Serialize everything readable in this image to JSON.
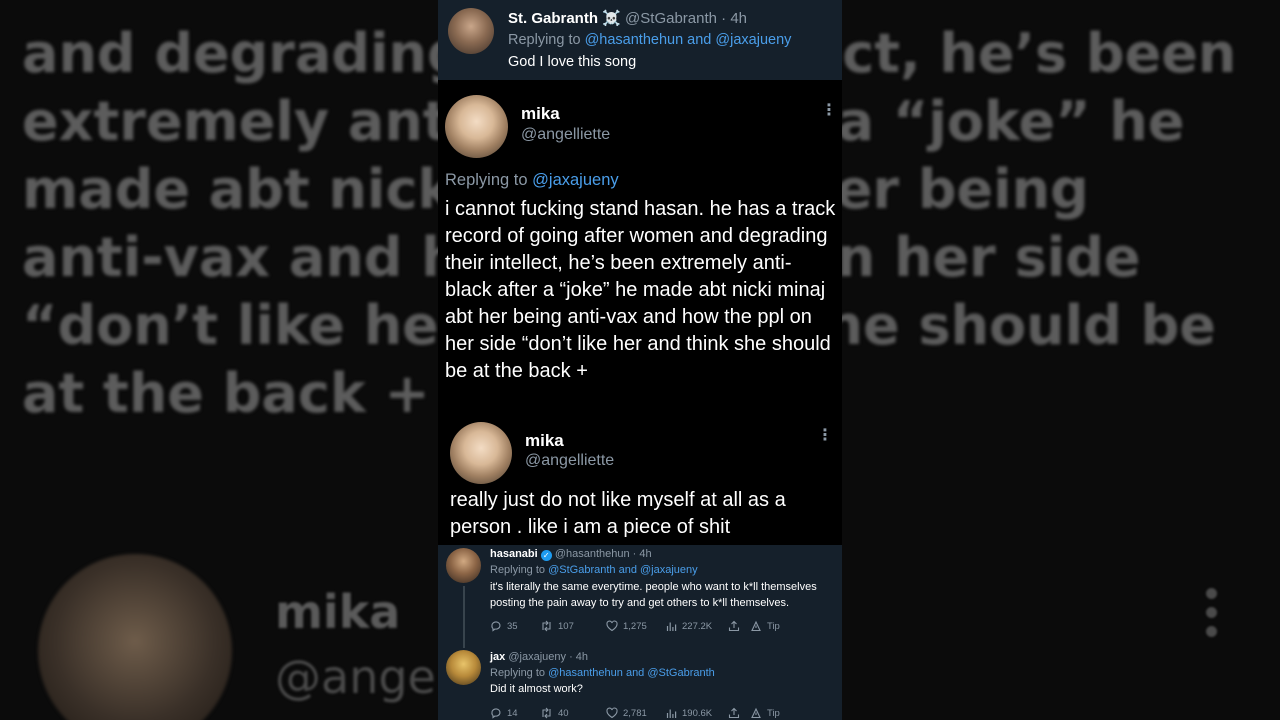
{
  "background": {
    "lines": [
      "and degrading their intellect, he’s been",
      "extremely anti-black after a “joke” he",
      "made abt nicki minaj abt her being",
      "anti-vax and how the ppl on her side",
      "“don’t like her and think she should be",
      "at the back +"
    ],
    "name": "mika",
    "handle": "@angelliette"
  },
  "tweet_top": {
    "name": "St. Gabranth",
    "emoji": "☠️",
    "handle": "@StGabranth",
    "time": "· 4h",
    "replying_prefix": "Replying to",
    "replying_to": "@hasanthehun and @jaxajueny",
    "text": "God I love this song"
  },
  "tweet_mika_1": {
    "name": "mika",
    "handle": "@angelliette",
    "more_icon": "⋮",
    "replying_prefix": "Replying to",
    "replying_to": "@jaxajueny",
    "text": "i cannot fucking stand hasan. he has a track record of going after women and degrading their intellect, he’s been extremely anti-black after a “joke” he made abt nicki minaj abt her being anti-vax and how the ppl on her side “don’t like her and think she should be at the back +"
  },
  "tweet_mika_2": {
    "name": "mika",
    "handle": "@angelliette",
    "more_icon": "⋮",
    "text": "really just do not like myself at all as a person . like i am a piece of shit"
  },
  "tweet_hasan": {
    "name": "hasanabi",
    "verified_icon": "✓",
    "handle": "@hasanthehun",
    "time": "· 4h",
    "replying_prefix": "Replying to",
    "replying_to": "@StGabranth and @jaxajueny",
    "text": "it's literally the same everytime. people who want to k*ll themselves posting the pain away to try and get others to k*ll themselves.",
    "replies": "35",
    "retweets": "107",
    "likes": "1,275",
    "views": "227.2K",
    "tip": "Tip"
  },
  "tweet_jax": {
    "name": "jax",
    "handle": "@jaxajueny",
    "time": "· 4h",
    "replying_prefix": "Replying to",
    "replying_to": "@hasanthehun and @StGabranth",
    "text": "Did it almost work?",
    "replies": "14",
    "retweets": "40",
    "likes": "2,781",
    "views": "190.6K",
    "tip": "Tip"
  },
  "colors": {
    "dim_bg": "#15202b",
    "link": "#4a9eea",
    "muted": "#8b98a5",
    "verified": "#1d9bf0"
  }
}
